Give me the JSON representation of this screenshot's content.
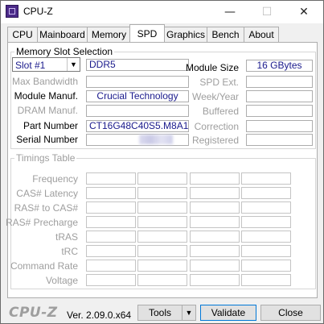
{
  "window": {
    "title": "CPU-Z",
    "minimize_glyph": "—",
    "maximize_glyph": "☐",
    "close_glyph": "✕"
  },
  "tabs": [
    {
      "label": "CPU",
      "active": false
    },
    {
      "label": "Mainboard",
      "active": false
    },
    {
      "label": "Memory",
      "active": false
    },
    {
      "label": "SPD",
      "active": true
    },
    {
      "label": "Graphics",
      "active": false
    },
    {
      "label": "Bench",
      "active": false
    },
    {
      "label": "About",
      "active": false
    }
  ],
  "memory_slot_selection": {
    "legend": "Memory Slot Selection",
    "slot_value": "Slot #1",
    "ddr_type": "DDR5",
    "labels": {
      "max_bandwidth": "Max Bandwidth",
      "module_manuf": "Module Manuf.",
      "dram_manuf": "DRAM Manuf.",
      "part_number": "Part Number",
      "serial_number": "Serial Number",
      "module_size": "Module Size",
      "spd_ext": "SPD Ext.",
      "week_year": "Week/Year",
      "buffered": "Buffered",
      "correction": "Correction",
      "registered": "Registered"
    },
    "values": {
      "max_bandwidth": "",
      "module_manuf": "Crucial Technology",
      "dram_manuf": "",
      "part_number": "CT16G48C40S5.M8A1",
      "serial_number": "",
      "module_size": "16 GBytes",
      "spd_ext": "",
      "week_year": "",
      "buffered": "",
      "correction": "",
      "registered": ""
    }
  },
  "timings_table": {
    "legend": "Timings Table",
    "rows": [
      "Frequency",
      "CAS# Latency",
      "RAS# to CAS#",
      "RAS# Precharge",
      "tRAS",
      "tRC",
      "Command Rate",
      "Voltage"
    ]
  },
  "footer": {
    "logo": "CPU-Z",
    "version": "Ver. 2.09.0.x64",
    "tools_label": "Tools",
    "validate_label": "Validate",
    "close_label": "Close"
  }
}
